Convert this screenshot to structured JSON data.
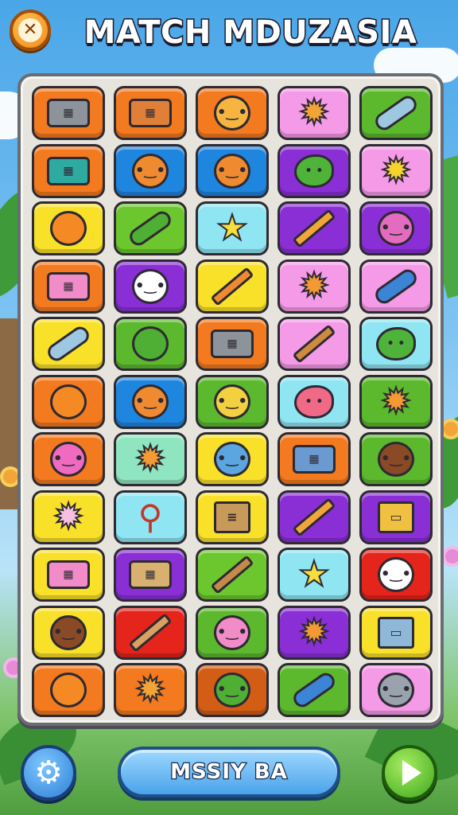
{
  "header": {
    "title": "MATCH MDUZASIA",
    "close_icon": "close-icon"
  },
  "board": {
    "columns": 5,
    "rows": 11,
    "tiles": [
      {
        "color": "#f47a1f",
        "icon": "gray-crate",
        "kind": "box",
        "ic": "#8c939a"
      },
      {
        "color": "#f47a1f",
        "icon": "orange-crate",
        "kind": "box",
        "ic": "#e08038"
      },
      {
        "color": "#f47a1f",
        "icon": "cat-face",
        "kind": "face",
        "ic": "#f5b540"
      },
      {
        "color": "#f59ae6",
        "icon": "fox-sun-face",
        "kind": "sun",
        "ic": "#f3a436"
      },
      {
        "color": "#5cb92e",
        "icon": "blue-tube",
        "kind": "tube",
        "ic": "#9ec8e2"
      },
      {
        "color": "#f47a1f",
        "icon": "teal-crate",
        "kind": "box",
        "ic": "#2eaaa0"
      },
      {
        "color": "#1f86e0",
        "icon": "bear-face",
        "kind": "face",
        "ic": "#f08a30"
      },
      {
        "color": "#1f86e0",
        "icon": "fox-face",
        "kind": "face",
        "ic": "#f08a30"
      },
      {
        "color": "#8a2fd6",
        "icon": "green-turtle",
        "kind": "blob",
        "ic": "#4fb33a"
      },
      {
        "color": "#f59ae6",
        "icon": "sun-face",
        "kind": "sun",
        "ic": "#f6d22e"
      },
      {
        "color": "#f9e12a",
        "icon": "orange-speech-bubble",
        "kind": "bubble",
        "ic": "#f58a25"
      },
      {
        "color": "#6cc72e",
        "icon": "green-telescope",
        "kind": "tube",
        "ic": "#4fae34"
      },
      {
        "color": "#8fe5f2",
        "icon": "yellow-star",
        "kind": "star",
        "ic": "#f6de3c"
      },
      {
        "color": "#8a2fd6",
        "icon": "orange-pencil",
        "kind": "pencil",
        "ic": "#f2a63a"
      },
      {
        "color": "#8a2fd6",
        "icon": "pink-bear-face",
        "kind": "face",
        "ic": "#e36bc0"
      },
      {
        "color": "#f47a1f",
        "icon": "pink-crate",
        "kind": "box",
        "ic": "#f28cc8"
      },
      {
        "color": "#8a2fd6",
        "icon": "white-ghost",
        "kind": "face",
        "ic": "#ffffff"
      },
      {
        "color": "#f9e12a",
        "icon": "orange-pencil",
        "kind": "pencil",
        "ic": "#f08a30"
      },
      {
        "color": "#f59ae6",
        "icon": "orange-star-face",
        "kind": "sun",
        "ic": "#f39a35"
      },
      {
        "color": "#f59ae6",
        "icon": "blue-telescope",
        "kind": "tube",
        "ic": "#3c84d6"
      },
      {
        "color": "#f9e12a",
        "icon": "blue-tube",
        "kind": "tube",
        "ic": "#9ec8e2"
      },
      {
        "color": "#5cb92e",
        "icon": "green-ball",
        "kind": "bubble",
        "ic": "#4fae34"
      },
      {
        "color": "#f47a1f",
        "icon": "gray-crate",
        "kind": "box",
        "ic": "#8c939a"
      },
      {
        "color": "#f59ae6",
        "icon": "brown-pencil",
        "kind": "pencil",
        "ic": "#d08a40"
      },
      {
        "color": "#8fe5f2",
        "icon": "green-turtle",
        "kind": "blob",
        "ic": "#4fb33a"
      },
      {
        "color": "#f47a1f",
        "icon": "orange-fruit",
        "kind": "bubble",
        "ic": "#f58a25"
      },
      {
        "color": "#1f86e0",
        "icon": "bear-face",
        "kind": "face",
        "ic": "#f08a30"
      },
      {
        "color": "#5cb92e",
        "icon": "yellow-cat",
        "kind": "face",
        "ic": "#f3d040"
      },
      {
        "color": "#8fe5f2",
        "icon": "pink-blob",
        "kind": "blob",
        "ic": "#f06a88"
      },
      {
        "color": "#5cb92e",
        "icon": "lion-face",
        "kind": "sun",
        "ic": "#f39a35"
      },
      {
        "color": "#f47a1f",
        "icon": "pink-bear-face",
        "kind": "face",
        "ic": "#f06ac0"
      },
      {
        "color": "#8fe5bf",
        "icon": "orange-star-face",
        "kind": "sun",
        "ic": "#f39a35"
      },
      {
        "color": "#f9e12a",
        "icon": "blue-cat",
        "kind": "face",
        "ic": "#5ba6e0"
      },
      {
        "color": "#f47a1f",
        "icon": "blue-crate",
        "kind": "box",
        "ic": "#6a9ad0"
      },
      {
        "color": "#5cb92e",
        "icon": "brown-bear-face",
        "kind": "face",
        "ic": "#8a4a25"
      },
      {
        "color": "#f9e12a",
        "icon": "pink-porcupine",
        "kind": "sun",
        "ic": "#f7c0e0"
      },
      {
        "color": "#8fe5f2",
        "icon": "magnifier",
        "kind": "magnifier",
        "ic": "#c0392b"
      },
      {
        "color": "#f9e12a",
        "icon": "book-stack",
        "kind": "book",
        "ic": "#c89a5a"
      },
      {
        "color": "#8a2fd6",
        "icon": "orange-pencil",
        "kind": "pencil",
        "ic": "#f2a63a"
      },
      {
        "color": "#8a2fd6",
        "icon": "computer-desk",
        "kind": "device",
        "ic": "#f0c040"
      },
      {
        "color": "#f9e12a",
        "icon": "pink-box",
        "kind": "box",
        "ic": "#f28cc8"
      },
      {
        "color": "#8a2fd6",
        "icon": "tan-box",
        "kind": "box",
        "ic": "#d8b070"
      },
      {
        "color": "#6cc72e",
        "icon": "hammer",
        "kind": "pencil",
        "ic": "#c48a4a"
      },
      {
        "color": "#8fe5f2",
        "icon": "yellow-star",
        "kind": "star",
        "ic": "#f6de3c"
      },
      {
        "color": "#e5241b",
        "icon": "white-bear-face",
        "kind": "face",
        "ic": "#ffffff"
      },
      {
        "color": "#f9e12a",
        "icon": "brown-bear-face",
        "kind": "face",
        "ic": "#8a4a25"
      },
      {
        "color": "#e5241b",
        "icon": "brown-pencil",
        "kind": "pencil",
        "ic": "#d9a060"
      },
      {
        "color": "#5cb92e",
        "icon": "pink-cat-face",
        "kind": "face",
        "ic": "#f28cc8"
      },
      {
        "color": "#8a2fd6",
        "icon": "orange-star-face",
        "kind": "sun",
        "ic": "#f39a35"
      },
      {
        "color": "#f9e12a",
        "icon": "computer-chair",
        "kind": "device",
        "ic": "#8fb8d8"
      },
      {
        "color": "#f47a1f",
        "icon": "orange-fruit",
        "kind": "bubble",
        "ic": "#f58a25"
      },
      {
        "color": "#f47a1f",
        "icon": "fox-sun-face",
        "kind": "sun",
        "ic": "#f3a436"
      },
      {
        "color": "#d45d16",
        "icon": "green-frog-face",
        "kind": "face",
        "ic": "#4fae34"
      },
      {
        "color": "#5cb92e",
        "icon": "blue-telescope",
        "kind": "tube",
        "ic": "#3c84d6"
      },
      {
        "color": "#f59ae6",
        "icon": "gray-mouse-face",
        "kind": "face",
        "ic": "#9aa3ad"
      }
    ]
  },
  "footer": {
    "settings_icon": "gear-icon",
    "action_label": "MSSIY BA",
    "play_icon": "play-icon"
  }
}
